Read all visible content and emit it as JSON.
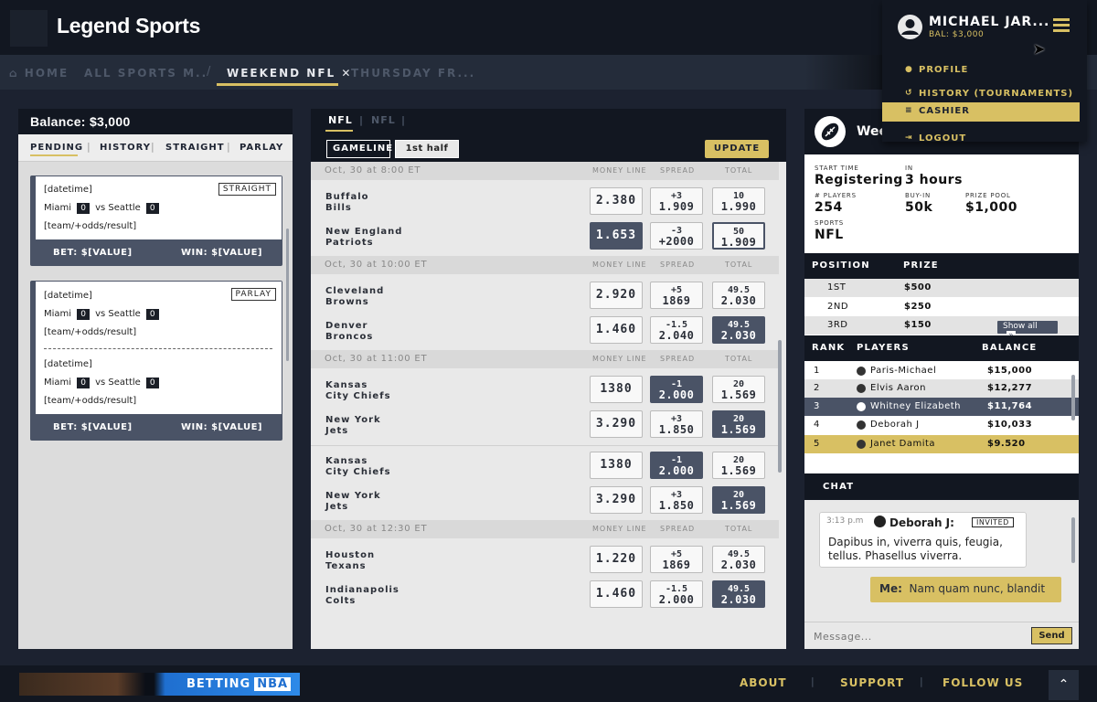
{
  "header": {
    "brand": "Legend Sports"
  },
  "breadcrumbs": [
    {
      "label": "HOME"
    },
    {
      "label": "ALL SPORTS M.."
    },
    {
      "label": "WEEKEND NFL"
    },
    {
      "label": "THURSDAY FR..."
    }
  ],
  "user": {
    "name": "MICHAEL JAR...",
    "balance": "BAL: $3,000",
    "menu": [
      {
        "label": "PROFILE",
        "icon": "user-circle-icon"
      },
      {
        "label": "HISTORY (TOURNAMENTS)",
        "icon": "history-icon"
      },
      {
        "label": "CASHIER",
        "icon": "coins-icon"
      },
      {
        "label": "LOGOUT",
        "icon": "logout-icon"
      }
    ]
  },
  "bet_slip": {
    "title": "Balance: $3,000",
    "tabs": [
      "PENDING",
      "HISTORY",
      "STRAIGHT",
      "PARLAY"
    ],
    "tickets": [
      {
        "type": "STRAIGHT",
        "lines": [
          {
            "datetime": "[datetime]",
            "home": "Miami",
            "home_score": "0",
            "vs": "vs",
            "away": "Seattle",
            "away_score": "0",
            "result": "[team/+odds/result]"
          }
        ],
        "bet": "BET: $[VALUE]",
        "win": "WIN: $[VALUE]"
      },
      {
        "type": "PARLAY",
        "lines": [
          {
            "datetime": "[datetime]",
            "home": "Miami",
            "home_score": "0",
            "vs": "vs",
            "away": "Seattle",
            "away_score": "0",
            "result": "[team/+odds/result]"
          },
          {
            "datetime": "[datetime]",
            "home": "Miami",
            "home_score": "0",
            "vs": "vs",
            "away": "Seattle",
            "away_score": "0",
            "result": "[team/+odds/result]"
          }
        ],
        "bet": "BET: $[VALUE]",
        "win": "WIN: $[VALUE]"
      }
    ]
  },
  "center": {
    "tabs": [
      "NFL",
      "NFL"
    ],
    "filters": [
      "GAMELINE",
      "1st half"
    ],
    "update_label": "UPDATE",
    "col_headers": [
      "MONEY LINE",
      "SPREAD",
      "TOTAL"
    ],
    "sections": [
      {
        "datetime": "Oct, 30 at 8:00 ET",
        "games": [
          [
            {
              "team": [
                "Buffalo",
                "Bills"
              ],
              "money": "2.380",
              "spread": [
                "+3",
                "1.909"
              ],
              "total": [
                "10",
                "1.990"
              ],
              "hl": ""
            },
            {
              "team": [
                "New England",
                "Patriots"
              ],
              "money": "1.653",
              "spread": [
                "-3",
                "+2000"
              ],
              "total": [
                "50",
                "1.909"
              ],
              "hl": "money-dark total-outline"
            }
          ]
        ]
      },
      {
        "datetime": "Oct, 30 at 10:00 ET",
        "games": [
          [
            {
              "team": [
                "Cleveland",
                "Browns"
              ],
              "money": "2.920",
              "spread": [
                "+5",
                "1869"
              ],
              "total": [
                "49.5",
                "2.030"
              ],
              "hl": ""
            },
            {
              "team": [
                "Denver",
                "Broncos"
              ],
              "money": "1.460",
              "spread": [
                "-1.5",
                "2.040"
              ],
              "total": [
                "49.5",
                "2.030"
              ],
              "hl": "total-dark"
            }
          ]
        ]
      },
      {
        "datetime": "Oct, 30 at 11:00 ET",
        "games": [
          [
            {
              "team": [
                "Kansas",
                "City Chiefs"
              ],
              "money": "1380",
              "spread": [
                "-1",
                "2.000"
              ],
              "total": [
                "20",
                "1.569"
              ],
              "hl": "spread-dark"
            },
            {
              "team": [
                "New York",
                "Jets"
              ],
              "money": "3.290",
              "spread": [
                "+3",
                "1.850"
              ],
              "total": [
                "20",
                "1.569"
              ],
              "hl": "total-dark"
            }
          ],
          [
            {
              "team": [
                "Kansas",
                "City Chiefs"
              ],
              "money": "1380",
              "spread": [
                "-1",
                "2.000"
              ],
              "total": [
                "20",
                "1.569"
              ],
              "hl": "spread-dark"
            },
            {
              "team": [
                "New York",
                "Jets"
              ],
              "money": "3.290",
              "spread": [
                "+3",
                "1.850"
              ],
              "total": [
                "20",
                "1.569"
              ],
              "hl": "total-dark"
            }
          ]
        ]
      },
      {
        "datetime": "Oct, 30 at 12:30 ET",
        "games": [
          [
            {
              "team": [
                "Houston",
                "Texans"
              ],
              "money": "1.220",
              "spread": [
                "+5",
                "1869"
              ],
              "total": [
                "49.5",
                "2.030"
              ],
              "hl": ""
            },
            {
              "team": [
                "Indianapolis",
                "Colts"
              ],
              "money": "1.460",
              "spread": [
                "-1.5",
                "2.000"
              ],
              "total": [
                "49.5",
                "2.030"
              ],
              "hl": "total-dark"
            }
          ]
        ]
      }
    ]
  },
  "tournament": {
    "title": "Wee",
    "info": [
      {
        "label": "START TIME",
        "value": "Registering"
      },
      {
        "label": "IN",
        "value": "3 hours"
      },
      {
        "label": "# PLAYERS",
        "value": "254"
      },
      {
        "label": "BUY-IN",
        "value": "50k"
      },
      {
        "label": "PRIZE POOL",
        "value": "$1,000"
      },
      {
        "label": "SPORTS",
        "value": "NFL"
      }
    ],
    "prize_headers": [
      "POSITION",
      "PRIZE"
    ],
    "prizes": [
      {
        "position": "1ST",
        "prize": "$500"
      },
      {
        "position": "2ND",
        "prize": "$250"
      },
      {
        "position": "3RD",
        "prize": "$150"
      }
    ],
    "show_all": "Show all",
    "rank_headers": [
      "RANK",
      "PLAYERS",
      "BALANCE"
    ],
    "ranks": [
      {
        "rank": "1",
        "player": "Paris-Michael",
        "balance": "$15,000"
      },
      {
        "rank": "2",
        "player": "Elvis Aaron",
        "balance": "$12,277"
      },
      {
        "rank": "3",
        "player": "Whitney Elizabeth",
        "balance": "$11,764"
      },
      {
        "rank": "4",
        "player": "Deborah J",
        "balance": "$10,033"
      },
      {
        "rank": "5",
        "player": "Janet Damita",
        "balance": "$9.520"
      }
    ]
  },
  "chat": {
    "title": "CHAT",
    "message": {
      "time": "3:13 p.m",
      "author": "Deborah J:",
      "badge": "INVITED",
      "text": "Dapibus in, viverra quis, feugia, tellus. Phasellus viverra."
    },
    "me": {
      "label": "Me:",
      "text": "Nam quam nunc, blandit"
    },
    "placeholder": "Message...",
    "send": "Send"
  },
  "footer": {
    "banner_text": "BETTING",
    "banner_brand": "NBA",
    "links": [
      "ABOUT",
      "SUPPORT",
      "FOLLOW US"
    ]
  },
  "colors": {
    "accent": "#d8c063",
    "dark": "#121721",
    "highlight": "#4a5366"
  }
}
